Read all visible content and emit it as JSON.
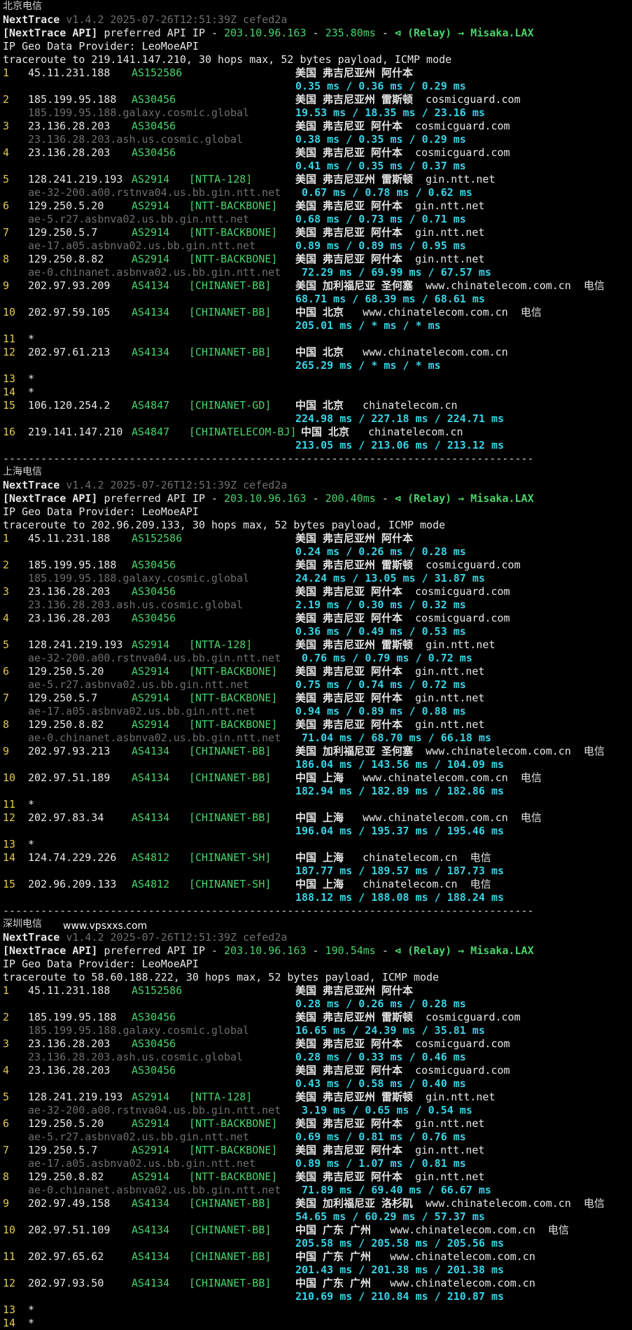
{
  "watermark": "www.vpsxxs.com",
  "sections": [
    {
      "title": "北京电信",
      "header": {
        "name": "NextTrace",
        "version": "v1.4.2 2025-07-26T12:51:39Z cefed2a",
        "api_prefix": "[NextTrace API]",
        "api_text": "preferred API IP -",
        "api_ip": "203.10.96.163",
        "api_latency": "235.80ms",
        "api_relay": "(Relay) → Misaka.LAX",
        "geo_provider": "IP Geo Data Provider: LeoMoeAPI",
        "traceroute": "traceroute to 219.141.147.210, 30 hops max, 52 bytes payload, ICMP mode"
      },
      "hops": [
        {
          "n": "1",
          "ip": "45.11.231.188",
          "asn": "AS152586",
          "tag": "",
          "host": "",
          "geo": "美国 弗吉尼亚州 阿什本",
          "owner": "",
          "latency": "0.35 ms / 0.36 ms / 0.29 ms"
        },
        {
          "n": "2",
          "ip": "185.199.95.188",
          "asn": "AS30456",
          "tag": "",
          "host": "185.199.95.188.galaxy.cosmic.global",
          "geo": "美国 弗吉尼亚州 雷斯顿",
          "owner": "cosmicguard.com",
          "latency": "19.53 ms / 18.35 ms / 23.16 ms"
        },
        {
          "n": "3",
          "ip": "23.136.28.203",
          "asn": "AS30456",
          "tag": "",
          "host": "23.136.28.203.ash.us.cosmic.global",
          "geo": "美国 弗吉尼亚 阿什本",
          "owner": "cosmicguard.com",
          "latency": "0.38 ms / 0.35 ms / 0.29 ms"
        },
        {
          "n": "4",
          "ip": "23.136.28.203",
          "asn": "AS30456",
          "tag": "",
          "host": "",
          "geo": "美国 弗吉尼亚 阿什本",
          "owner": "cosmicguard.com",
          "latency": "0.41 ms / 0.35 ms / 0.37 ms"
        },
        {
          "n": "5",
          "ip": "128.241.219.193",
          "asn": "AS2914",
          "tag": "[NTTA-128]",
          "host": "ae-32-200.a00.rstnva04.us.bb.gin.ntt.net",
          "geo": "美国 弗吉尼亚州 雷斯顿",
          "owner": "gin.ntt.net",
          "latency": " 0.67 ms / 0.78 ms / 0.62 ms"
        },
        {
          "n": "6",
          "ip": "129.250.5.20",
          "asn": "AS2914",
          "tag": "[NTT-BACKBONE]",
          "host": "ae-5.r27.asbnva02.us.bb.gin.ntt.net",
          "geo": "美国 弗吉尼亚 阿什本",
          "owner": "gin.ntt.net",
          "latency": "0.68 ms / 0.73 ms / 0.71 ms"
        },
        {
          "n": "7",
          "ip": "129.250.5.7",
          "asn": "AS2914",
          "tag": "[NTT-BACKBONE]",
          "host": "ae-17.a05.asbnva02.us.bb.gin.ntt.net",
          "geo": "美国 弗吉尼亚 阿什本",
          "owner": "gin.ntt.net",
          "latency": "0.89 ms / 0.89 ms / 0.95 ms"
        },
        {
          "n": "8",
          "ip": "129.250.8.82",
          "asn": "AS2914",
          "tag": "[NTT-BACKBONE]",
          "host": "ae-0.chinanet.asbnva02.us.bb.gin.ntt.net",
          "geo": "美国 弗吉尼亚 阿什本",
          "owner": "gin.ntt.net",
          "latency": " 72.29 ms / 69.99 ms / 67.57 ms"
        },
        {
          "n": "9",
          "ip": "202.97.93.209",
          "asn": "AS4134",
          "tag": "[CHINANET-BB]",
          "host": "",
          "geo": "美国 加利福尼亚 圣何塞",
          "owner": "www.chinatelecom.com.cn  电信",
          "latency": "68.71 ms / 68.39 ms / 68.61 ms"
        },
        {
          "n": "10",
          "ip": "202.97.59.105",
          "asn": "AS4134",
          "tag": "[CHINANET-BB]",
          "host": "",
          "geo": "中国 北京",
          "owner": " www.chinatelecom.com.cn  电信",
          "latency": "205.01 ms / * ms / * ms",
          "gap_after": true
        },
        {
          "n": "11",
          "star": true
        },
        {
          "n": "12",
          "ip": "202.97.61.213",
          "asn": "AS4134",
          "tag": "[CHINANET-BB]",
          "host": "",
          "geo": "中国 北京",
          "owner": " www.chinatelecom.com.cn",
          "latency": "265.29 ms / * ms / * ms",
          "gap_after": true
        },
        {
          "n": "13",
          "star": true
        },
        {
          "n": "14",
          "star": true
        },
        {
          "n": "15",
          "ip": "106.120.254.2",
          "asn": "AS4847",
          "tag": "[CHINANET-GD]",
          "host": "",
          "geo": "中国 北京",
          "owner": " chinatelecom.cn",
          "latency": "224.98 ms / 227.18 ms / 224.71 ms",
          "gap_before": true,
          "gap_after": true
        },
        {
          "n": "16",
          "ip": "219.141.147.210",
          "asn": "AS4847",
          "tag": "[CHINATELECOM-BJ]",
          "host": "",
          "geo": "中国 北京",
          "owner": " chinatelecom.cn",
          "latency": "213.05 ms / 213.06 ms / 213.12 ms",
          "shift": true
        }
      ]
    },
    {
      "title": "上海电信",
      "header": {
        "name": "NextTrace",
        "version": "v1.4.2 2025-07-26T12:51:39Z cefed2a",
        "api_prefix": "[NextTrace API]",
        "api_text": "preferred API IP -",
        "api_ip": "203.10.96.163",
        "api_latency": "200.40ms",
        "api_relay": "(Relay) → Misaka.LAX",
        "geo_provider": "IP Geo Data Provider: LeoMoeAPI",
        "traceroute": "traceroute to 202.96.209.133, 30 hops max, 52 bytes payload, ICMP mode"
      },
      "hops": [
        {
          "n": "1",
          "ip": "45.11.231.188",
          "asn": "AS152586",
          "tag": "",
          "host": "",
          "geo": "美国 弗吉尼亚州 阿什本",
          "owner": "",
          "latency": "0.24 ms / 0.26 ms / 0.28 ms"
        },
        {
          "n": "2",
          "ip": "185.199.95.188",
          "asn": "AS30456",
          "tag": "",
          "host": "185.199.95.188.galaxy.cosmic.global",
          "geo": "美国 弗吉尼亚州 雷斯顿",
          "owner": "cosmicguard.com",
          "latency": "24.24 ms / 13.05 ms / 31.87 ms"
        },
        {
          "n": "3",
          "ip": "23.136.28.203",
          "asn": "AS30456",
          "tag": "",
          "host": "23.136.28.203.ash.us.cosmic.global",
          "geo": "美国 弗吉尼亚 阿什本",
          "owner": "cosmicguard.com",
          "latency": "2.19 ms / 0.30 ms / 0.32 ms"
        },
        {
          "n": "4",
          "ip": "23.136.28.203",
          "asn": "AS30456",
          "tag": "",
          "host": "",
          "geo": "美国 弗吉尼亚 阿什本",
          "owner": "cosmicguard.com",
          "latency": "0.36 ms / 0.49 ms / 0.53 ms"
        },
        {
          "n": "5",
          "ip": "128.241.219.193",
          "asn": "AS2914",
          "tag": "[NTTA-128]",
          "host": "ae-32-200.a00.rstnva04.us.bb.gin.ntt.net",
          "geo": "美国 弗吉尼亚州 雷斯顿",
          "owner": "gin.ntt.net",
          "latency": " 0.76 ms / 0.79 ms / 0.72 ms"
        },
        {
          "n": "6",
          "ip": "129.250.5.20",
          "asn": "AS2914",
          "tag": "[NTT-BACKBONE]",
          "host": "ae-5.r27.asbnva02.us.bb.gin.ntt.net",
          "geo": "美国 弗吉尼亚 阿什本",
          "owner": "gin.ntt.net",
          "latency": "0.75 ms / 0.74 ms / 0.72 ms"
        },
        {
          "n": "7",
          "ip": "129.250.5.7",
          "asn": "AS2914",
          "tag": "[NTT-BACKBONE]",
          "host": "ae-17.a05.asbnva02.us.bb.gin.ntt.net",
          "geo": "美国 弗吉尼亚 阿什本",
          "owner": "gin.ntt.net",
          "latency": "0.94 ms / 0.89 ms / 0.88 ms"
        },
        {
          "n": "8",
          "ip": "129.250.8.82",
          "asn": "AS2914",
          "tag": "[NTT-BACKBONE]",
          "host": "ae-0.chinanet.asbnva02.us.bb.gin.ntt.net",
          "geo": "美国 弗吉尼亚 阿什本",
          "owner": "gin.ntt.net",
          "latency": " 71.04 ms / 68.70 ms / 66.18 ms"
        },
        {
          "n": "9",
          "ip": "202.97.93.213",
          "asn": "AS4134",
          "tag": "[CHINANET-BB]",
          "host": "",
          "geo": "美国 加利福尼亚 圣何塞",
          "owner": "www.chinatelecom.com.cn  电信",
          "latency": "186.04 ms / 143.56 ms / 104.09 ms"
        },
        {
          "n": "10",
          "ip": "202.97.51.189",
          "asn": "AS4134",
          "tag": "[CHINANET-BB]",
          "host": "",
          "geo": "中国 上海",
          "owner": " www.chinatelecom.com.cn  电信",
          "latency": "182.94 ms / 182.89 ms / 182.86 ms",
          "gap_after": true
        },
        {
          "n": "11",
          "star": true
        },
        {
          "n": "12",
          "ip": "202.97.83.34",
          "asn": "AS4134",
          "tag": "[CHINANET-BB]",
          "host": "",
          "geo": "中国 上海",
          "owner": " www.chinatelecom.com.cn  电信",
          "latency": "196.04 ms / 195.37 ms / 195.46 ms",
          "gap_after": true
        },
        {
          "n": "13",
          "star": true
        },
        {
          "n": "14",
          "ip": "124.74.229.226",
          "asn": "AS4812",
          "tag": "[CHINANET-SH]",
          "host": "",
          "geo": "中国 上海",
          "owner": " chinatelecom.cn  电信",
          "latency": "187.77 ms / 189.57 ms / 187.73 ms",
          "gap_before": true
        },
        {
          "n": "15",
          "ip": "202.96.209.133",
          "asn": "AS4812",
          "tag": "[CHINANET-SH]",
          "host": "",
          "geo": "中国 上海",
          "owner": " chinatelecom.cn  电信",
          "latency": "188.12 ms / 188.08 ms / 188.24 ms"
        }
      ]
    },
    {
      "title": "深圳电信",
      "header": {
        "name": "NextTrace",
        "version": "v1.4.2 2025-07-26T12:51:39Z cefed2a",
        "api_prefix": "[NextTrace API]",
        "api_text": "preferred API IP -",
        "api_ip": "203.10.96.163",
        "api_latency": "190.54ms",
        "api_relay": "(Relay) → Misaka.LAX",
        "geo_provider": "IP Geo Data Provider: LeoMoeAPI",
        "traceroute": "traceroute to 58.60.188.222, 30 hops max, 52 bytes payload, ICMP mode"
      },
      "hops": [
        {
          "n": "1",
          "ip": "45.11.231.188",
          "asn": "AS152586",
          "tag": "",
          "host": "",
          "geo": "美国 弗吉尼亚州 阿什本",
          "owner": "",
          "latency": "0.28 ms / 0.26 ms / 0.28 ms"
        },
        {
          "n": "2",
          "ip": "185.199.95.188",
          "asn": "AS30456",
          "tag": "",
          "host": "185.199.95.188.galaxy.cosmic.global",
          "geo": "美国 弗吉尼亚州 雷斯顿",
          "owner": "cosmicguard.com",
          "latency": "16.65 ms / 24.39 ms / 35.81 ms"
        },
        {
          "n": "3",
          "ip": "23.136.28.203",
          "asn": "AS30456",
          "tag": "",
          "host": "23.136.28.203.ash.us.cosmic.global",
          "geo": "美国 弗吉尼亚 阿什本",
          "owner": "cosmicguard.com",
          "latency": "0.28 ms / 0.33 ms / 0.46 ms"
        },
        {
          "n": "4",
          "ip": "23.136.28.203",
          "asn": "AS30456",
          "tag": "",
          "host": "",
          "geo": "美国 弗吉尼亚 阿什本",
          "owner": "cosmicguard.com",
          "latency": "0.43 ms / 0.58 ms / 0.40 ms"
        },
        {
          "n": "5",
          "ip": "128.241.219.193",
          "asn": "AS2914",
          "tag": "[NTTA-128]",
          "host": "ae-32-200.a00.rstnva04.us.bb.gin.ntt.net",
          "geo": "美国 弗吉尼亚州 雷斯顿",
          "owner": "gin.ntt.net",
          "latency": " 3.19 ms / 0.65 ms / 0.54 ms"
        },
        {
          "n": "6",
          "ip": "129.250.5.20",
          "asn": "AS2914",
          "tag": "[NTT-BACKBONE]",
          "host": "ae-5.r27.asbnva02.us.bb.gin.ntt.net",
          "geo": "美国 弗吉尼亚 阿什本",
          "owner": "gin.ntt.net",
          "latency": "0.69 ms / 0.81 ms / 0.76 ms"
        },
        {
          "n": "7",
          "ip": "129.250.5.7",
          "asn": "AS2914",
          "tag": "[NTT-BACKBONE]",
          "host": "ae-17.a05.asbnva02.us.bb.gin.ntt.net",
          "geo": "美国 弗吉尼亚 阿什本",
          "owner": "gin.ntt.net",
          "latency": "0.89 ms / 1.07 ms / 0.81 ms"
        },
        {
          "n": "8",
          "ip": "129.250.8.82",
          "asn": "AS2914",
          "tag": "[NTT-BACKBONE]",
          "host": "ae-0.chinanet.asbnva02.us.bb.gin.ntt.net",
          "geo": "美国 弗吉尼亚 阿什本",
          "owner": "gin.ntt.net",
          "latency": " 71.89 ms / 69.40 ms / 66.67 ms"
        },
        {
          "n": "9",
          "ip": "202.97.49.158",
          "asn": "AS4134",
          "tag": "[CHINANET-BB]",
          "host": "",
          "geo": "美国 加利福尼亚 洛杉矶",
          "owner": "www.chinatelecom.com.cn  电信",
          "latency": "54.65 ms / 60.29 ms / 57.37 ms"
        },
        {
          "n": "10",
          "ip": "202.97.51.109",
          "asn": "AS4134",
          "tag": "[CHINANET-BB]",
          "host": "",
          "geo": "中国 广东 广州",
          "owner": " www.chinatelecom.com.cn  电信",
          "latency": "205.58 ms / 205.58 ms / 205.56 ms"
        },
        {
          "n": "11",
          "ip": "202.97.65.62",
          "asn": "AS4134",
          "tag": "[CHINANET-BB]",
          "host": "",
          "geo": "中国 广东 广州",
          "owner": " www.chinatelecom.com.cn",
          "latency": "201.43 ms / 201.38 ms / 201.38 ms"
        },
        {
          "n": "12",
          "ip": "202.97.93.50",
          "asn": "AS4134",
          "tag": "[CHINANET-BB]",
          "host": "",
          "geo": "中国 广东 广州",
          "owner": " www.chinatelecom.com.cn",
          "latency": "210.69 ms / 210.84 ms / 210.87 ms",
          "gap_after": true
        },
        {
          "n": "13",
          "star": true
        },
        {
          "n": "14",
          "star": true
        }
      ]
    }
  ],
  "separator": "------------------------------------------------------------------------------------"
}
